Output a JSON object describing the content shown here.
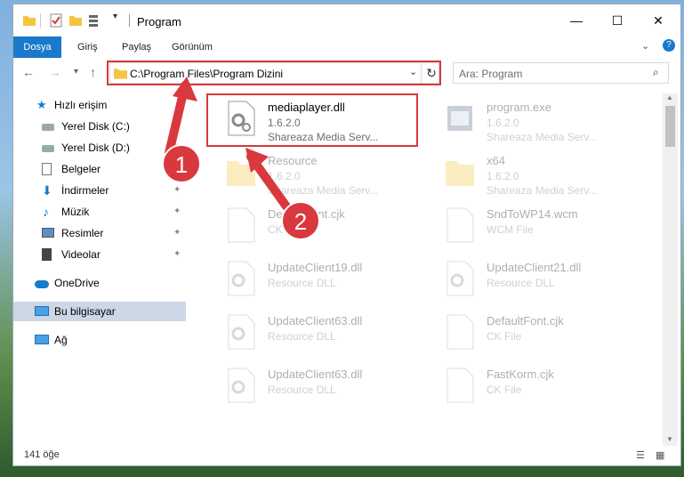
{
  "window": {
    "title": "Program"
  },
  "ribbon": {
    "tabs": [
      "Dosya",
      "Giriş",
      "Paylaş",
      "Görünüm"
    ]
  },
  "address": {
    "path": "C:\\Program Files\\Program Dizini"
  },
  "search": {
    "placeholder": "Ara: Program"
  },
  "sidebar": {
    "items": [
      {
        "label": "Hızlı erişim"
      },
      {
        "label": "Yerel Disk (C:)"
      },
      {
        "label": "Yerel Disk (D:)"
      },
      {
        "label": "Belgeler"
      },
      {
        "label": "İndirmeler"
      },
      {
        "label": "Müzik"
      },
      {
        "label": "Resimler"
      },
      {
        "label": "Videolar"
      },
      {
        "label": "OneDrive"
      },
      {
        "label": "Bu bilgisayar"
      },
      {
        "label": "Ağ"
      }
    ]
  },
  "files": [
    {
      "name": "mediaplayer.dll",
      "line2": "1.6.2.0",
      "line3": "Shareaza Media Serv..."
    },
    {
      "name": "program.exe",
      "line2": "1.6.2.0",
      "line3": "Shareaza Media Serv..."
    },
    {
      "name": "Resource",
      "line2": "1.6.2.0",
      "line3": "Shareaza Media Serv..."
    },
    {
      "name": "x64",
      "line2": "1.6.2.0",
      "line3": "Shareaza Media Serv..."
    },
    {
      "name": "DefaultFont.cjk",
      "line2": "CK File",
      "line3": ""
    },
    {
      "name": "SndToWP14.wcm",
      "line2": "WCM File",
      "line3": ""
    },
    {
      "name": "UpdateClient19.dll",
      "line2": "Resource DLL",
      "line3": ""
    },
    {
      "name": "UpdateClient21.dll",
      "line2": "Resource DLL",
      "line3": ""
    },
    {
      "name": "UpdateClient63.dll",
      "line2": "Resource DLL",
      "line3": ""
    },
    {
      "name": "DefaultFont.cjk",
      "line2": "CK File",
      "line3": ""
    },
    {
      "name": "UpdateClient63.dll",
      "line2": "Resource DLL",
      "line3": ""
    },
    {
      "name": "FastKorm.cjk",
      "line2": "CK File",
      "line3": ""
    }
  ],
  "status": {
    "count": "141 öğe"
  },
  "annotations": {
    "step1": "1",
    "step2": "2",
    "accent": "#d9383e"
  }
}
